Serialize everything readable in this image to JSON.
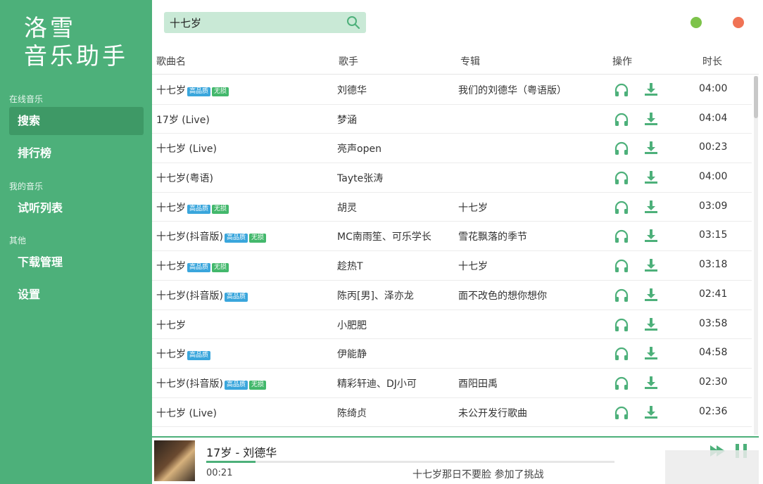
{
  "app": {
    "logo_line1": "洛雪",
    "logo_line2": "音乐助手"
  },
  "sidebar": {
    "sections": [
      {
        "label": "在线音乐",
        "items": [
          "搜索",
          "排行榜"
        ]
      },
      {
        "label": "我的音乐",
        "items": [
          "试听列表"
        ]
      },
      {
        "label": "其他",
        "items": [
          "下载管理",
          "设置"
        ]
      }
    ],
    "active": "搜索"
  },
  "search": {
    "value": "十七岁",
    "icon": "search-icon"
  },
  "colors": {
    "accent": "#4db07a",
    "min": "#7dc34a",
    "close": "#f07355",
    "tag_hq": "#3aa6dc",
    "tag_lossless": "#43b86c"
  },
  "table": {
    "headers": {
      "name": "歌曲名",
      "artist": "歌手",
      "album": "专辑",
      "ops": "操作",
      "duration": "时长"
    },
    "tag_labels": {
      "hq": "高品质",
      "lossless": "无损"
    },
    "rows": [
      {
        "name": "十七岁",
        "hq": true,
        "lossless": true,
        "artist": "刘德华",
        "album": "我们的刘德华（粤语版）",
        "duration": "04:00"
      },
      {
        "name": "17岁 (Live)",
        "hq": false,
        "lossless": false,
        "artist": "梦涵",
        "album": "",
        "duration": "04:04"
      },
      {
        "name": "十七岁 (Live)",
        "hq": false,
        "lossless": false,
        "artist": "亮声open",
        "album": "",
        "duration": "00:23"
      },
      {
        "name": "十七岁(粤语)",
        "hq": false,
        "lossless": false,
        "artist": "Tayte张涛",
        "album": "",
        "duration": "04:00"
      },
      {
        "name": "十七岁",
        "hq": true,
        "lossless": true,
        "artist": "胡灵",
        "album": "十七岁",
        "duration": "03:09"
      },
      {
        "name": "十七岁(抖音版)",
        "hq": true,
        "lossless": true,
        "artist": "MC南雨笙、可乐学长",
        "album": "雪花飘落的季节",
        "duration": "03:15"
      },
      {
        "name": "十七岁",
        "hq": true,
        "lossless": true,
        "artist": "趁热T",
        "album": "十七岁",
        "duration": "03:18"
      },
      {
        "name": "十七岁(抖音版)",
        "hq": true,
        "lossless": false,
        "artist": "陈丙[男]、泽亦龙",
        "album": "面不改色的想你想你",
        "duration": "02:41"
      },
      {
        "name": "十七岁",
        "hq": false,
        "lossless": false,
        "artist": "小肥肥",
        "album": "",
        "duration": "03:58"
      },
      {
        "name": "十七岁",
        "hq": true,
        "lossless": false,
        "artist": "伊能静",
        "album": "",
        "duration": "04:58"
      },
      {
        "name": "十七岁(抖音版)",
        "hq": true,
        "lossless": true,
        "artist": "精彩轩迪、DJ小可",
        "album": "酉阳田禹",
        "duration": "02:30"
      },
      {
        "name": "十七岁 (Live)",
        "hq": false,
        "lossless": false,
        "artist": "陈绮贞",
        "album": "未公开发行歌曲",
        "duration": "02:36"
      }
    ]
  },
  "player": {
    "now_playing": "17岁 - 刘德华",
    "current_time": "00:21",
    "progress": 0.12,
    "lyric": "十七岁那日不要脸 参加了挑战"
  }
}
